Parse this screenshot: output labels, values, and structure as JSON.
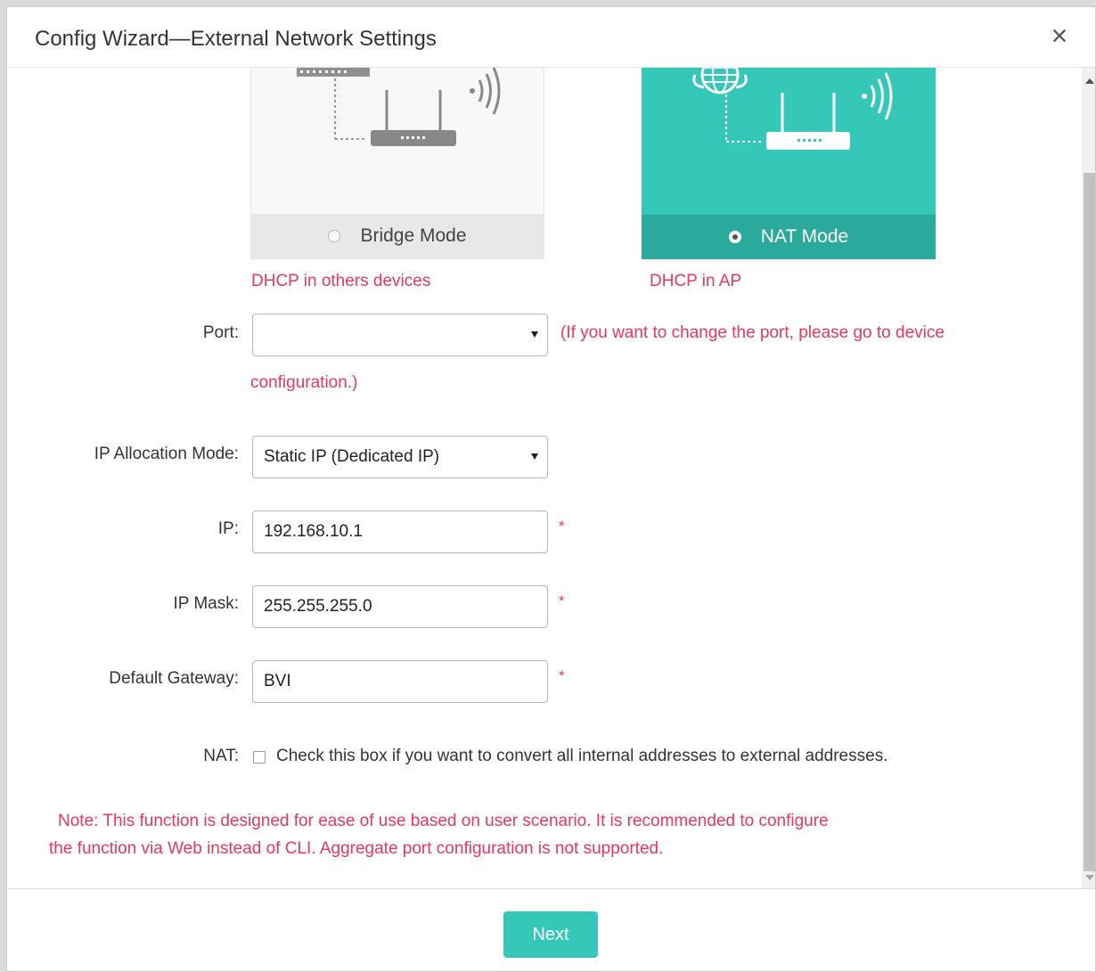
{
  "dialog": {
    "title": "Config Wizard—External Network Settings",
    "close_glyph": "×"
  },
  "modes": {
    "bridge": {
      "label": "Bridge Mode",
      "hint": "DHCP in others devices",
      "selected": false
    },
    "nat": {
      "label": "NAT Mode",
      "hint": "DHCP in AP",
      "selected": true
    }
  },
  "form": {
    "port": {
      "label": "Port:",
      "value": "",
      "hint_line1": "(If you want to change the port, please go to device",
      "hint_line2": "configuration.)"
    },
    "ip_allocation": {
      "label": "IP Allocation Mode:",
      "value": "Static IP (Dedicated IP)"
    },
    "ip": {
      "label": "IP:",
      "value": "192.168.10.1",
      "required": "*"
    },
    "ip_mask": {
      "label": "IP Mask:",
      "value": "255.255.255.0",
      "required": "*"
    },
    "gateway": {
      "label": "Default Gateway:",
      "value": "BVI",
      "required": "*"
    },
    "nat": {
      "label": "NAT:",
      "checkbox_text": "Check this box if you want to convert all internal addresses to external addresses.",
      "checked": false
    }
  },
  "note": {
    "line1": "Note:  This function is designed for ease of use based on user scenario. It is recommended to configure",
    "line2": "the function via Web instead of CLI. Aggregate port configuration is not supported."
  },
  "footer": {
    "next_label": "Next"
  },
  "colors": {
    "accent": "#35c8b8",
    "accent_dark": "#2ba99c",
    "warning_red": "#e8375d"
  }
}
